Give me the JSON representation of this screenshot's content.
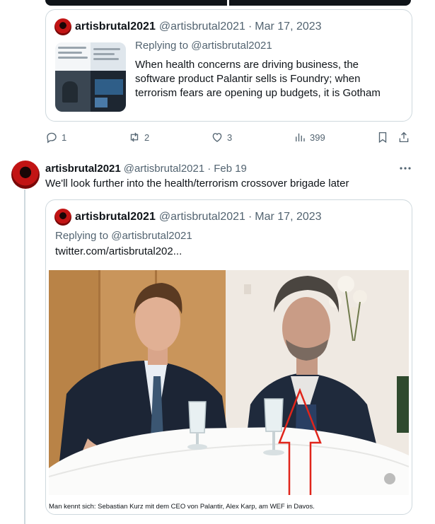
{
  "quoted_tweet_1": {
    "display_name": "artisbrutal2021",
    "handle": "@artisbrutal2021",
    "separator": "·",
    "date": "Mar 17, 2023",
    "replying_to": "Replying to @artisbrutal2021",
    "text": "When health concerns are driving business, the\nsoftware product Palantir sells is Foundry; when\nterrorism fears are opening up budgets, it is Gotham"
  },
  "tweet_actions": {
    "replies": "1",
    "retweets": "2",
    "likes": "3",
    "views": "399"
  },
  "tweet_2": {
    "display_name": "artisbrutal2021",
    "handle": "@artisbrutal2021",
    "separator": "·",
    "date": "Feb 19",
    "text": "We'll look further into the health/terrorism crossover brigade later"
  },
  "quoted_tweet_2": {
    "display_name": "artisbrutal2021",
    "handle": "@artisbrutal2021",
    "separator": "·",
    "date": "Mar 17, 2023",
    "replying_to": "Replying to @artisbrutal2021",
    "link": "twitter.com/artisbrutal202...",
    "image_caption": "Man kennt sich: Sebastian Kurz mit dem CEO von Palantir, Alex Karp, am WEF in Davos."
  },
  "colors": {
    "text_primary": "#0f1419",
    "text_secondary": "#536471",
    "border": "#cfd9de",
    "arrow_red": "#e0251b",
    "avatar_red": "#c21414"
  },
  "icons": [
    "reply-icon",
    "retweet-icon",
    "like-icon",
    "views-icon",
    "bookmark-icon",
    "share-icon",
    "more-icon"
  ]
}
